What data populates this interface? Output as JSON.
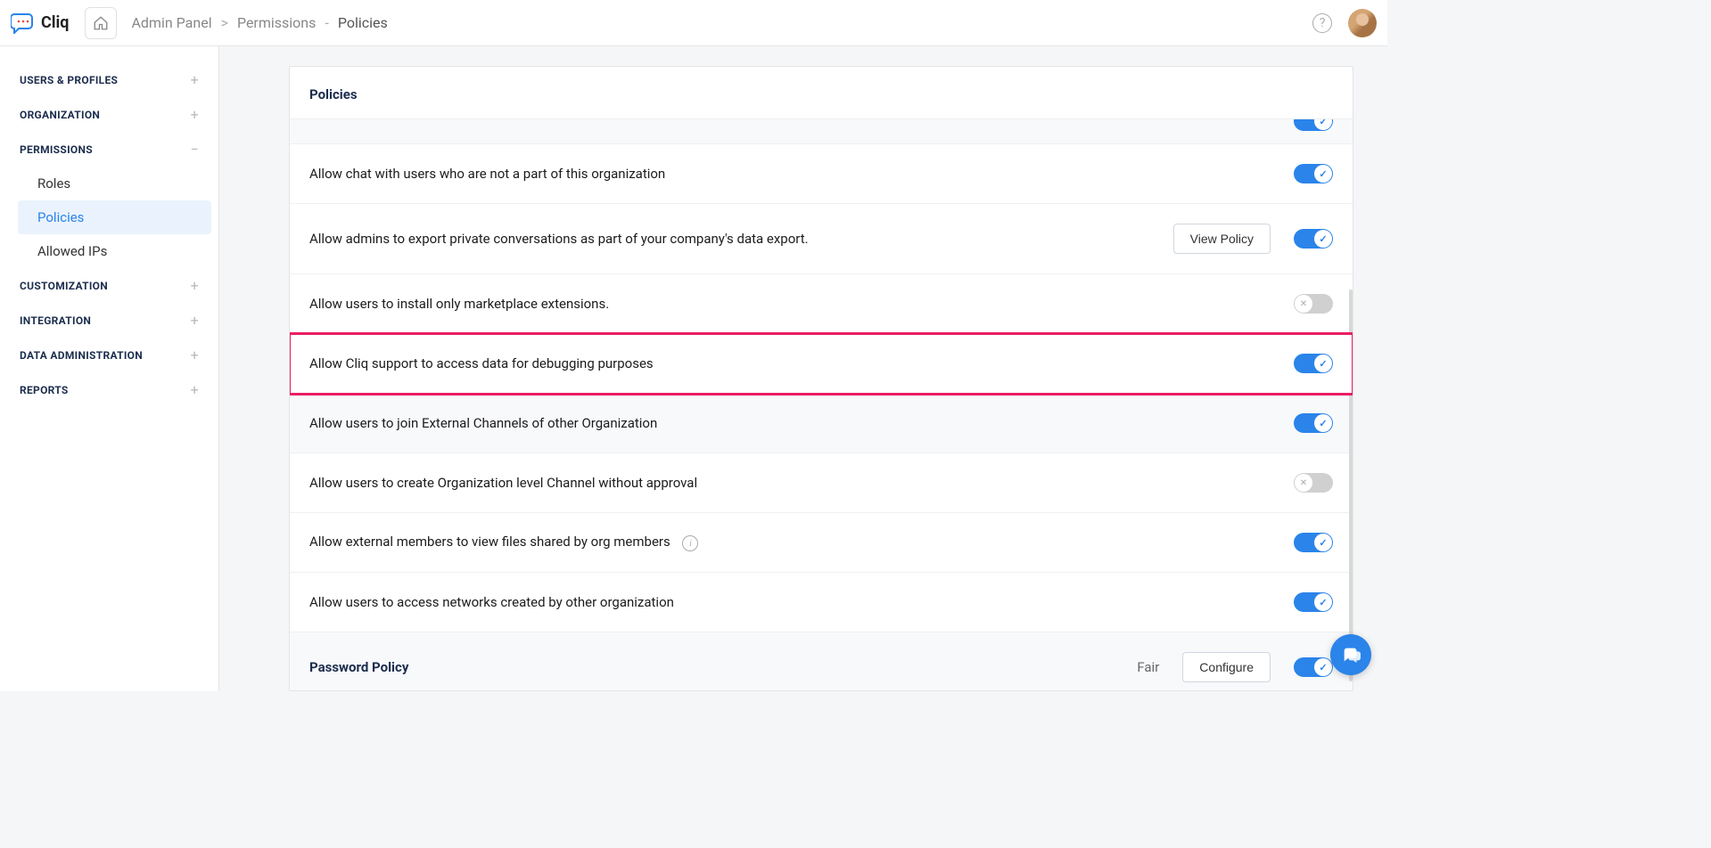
{
  "app": {
    "name": "Cliq"
  },
  "breadcrumb": {
    "root": "Admin Panel",
    "sep1": ">",
    "mid": "Permissions",
    "sep2": "-",
    "last": "Policies"
  },
  "sidebar": {
    "groups": [
      {
        "label": "USERS & PROFILES",
        "expand": "+"
      },
      {
        "label": "ORGANIZATION",
        "expand": "+"
      },
      {
        "label": "PERMISSIONS",
        "expand": "−"
      },
      {
        "label": "CUSTOMIZATION",
        "expand": "+"
      },
      {
        "label": "INTEGRATION",
        "expand": "+"
      },
      {
        "label": "DATA ADMINISTRATION",
        "expand": "+"
      },
      {
        "label": "REPORTS",
        "expand": "+"
      }
    ],
    "permissions_children": [
      {
        "label": "Roles"
      },
      {
        "label": "Policies"
      },
      {
        "label": "Allowed IPs"
      }
    ]
  },
  "card": {
    "title": "Policies"
  },
  "policies": {
    "view_policy_btn": "View Policy",
    "configure_btn": "Configure",
    "fair_status": "Fair",
    "rows": [
      {
        "label": "Allow chat with users who are not a part of this organization",
        "toggle": "on"
      },
      {
        "label": "Allow admins to export private conversations as part of your company's data export.",
        "toggle": "on",
        "view": true
      },
      {
        "label": "Allow users to install only marketplace extensions.",
        "toggle": "off"
      },
      {
        "label": "Allow Cliq support to access data for debugging purposes",
        "toggle": "on",
        "highlighted": true
      },
      {
        "label": "Allow users to join External Channels of other Organization",
        "toggle": "on",
        "alt": true
      },
      {
        "label": "Allow users to create Organization level Channel without approval",
        "toggle": "off"
      },
      {
        "label": "Allow external members to view files shared by org members",
        "toggle": "on",
        "info": true
      },
      {
        "label": "Allow users to access networks created by other organization",
        "toggle": "on"
      },
      {
        "label": "Password Policy",
        "toggle": "on",
        "alt": true,
        "bold": true,
        "configure": true,
        "status": true
      }
    ]
  }
}
